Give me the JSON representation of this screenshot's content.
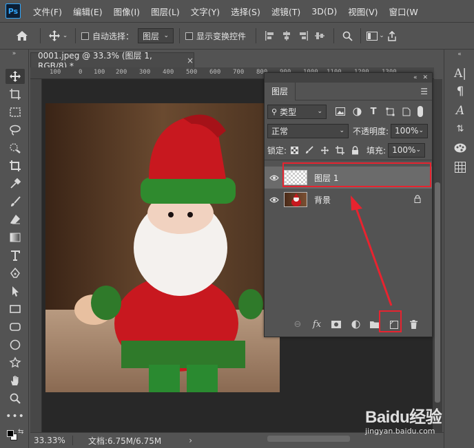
{
  "app": {
    "logo": "Ps"
  },
  "menu": [
    "文件(F)",
    "编辑(E)",
    "图像(I)",
    "图层(L)",
    "文字(Y)",
    "选择(S)",
    "滤镜(T)",
    "3D(D)",
    "视图(V)",
    "窗口(W"
  ],
  "options": {
    "auto_select_label": "自动选择：",
    "auto_select_target": "图层",
    "show_transform_label": "显示变换控件"
  },
  "document": {
    "tab_title": "0001.jpeg @ 33.3% (图层 1, RGB/8) *",
    "close_glyph": "×",
    "ruler_labels": [
      "100",
      "0",
      "100",
      "200",
      "300",
      "400",
      "500",
      "600",
      "700",
      "800",
      "900",
      "1000",
      "1100",
      "1200",
      "1300"
    ]
  },
  "status": {
    "zoom": "33.33%",
    "doc_info": "文档:6.75M/6.75M",
    "arrow": "›"
  },
  "layers_panel": {
    "tab": "图层",
    "filter_kind": "类型",
    "blend_mode": "正常",
    "opacity_label": "不透明度:",
    "opacity_value": "100%",
    "lock_label": "锁定:",
    "fill_label": "填充:",
    "fill_value": "100%",
    "layers": [
      {
        "name": "图层 1",
        "selected": true,
        "locked": false
      },
      {
        "name": "背景",
        "selected": false,
        "locked": true
      }
    ]
  },
  "watermark": {
    "brand": "Baidu经验",
    "url": "jingyan.baidu.com"
  },
  "colors": {
    "annotation_red": "#e8232f",
    "panel_bg": "#535353",
    "selected_layer": "#6b6b6b"
  }
}
